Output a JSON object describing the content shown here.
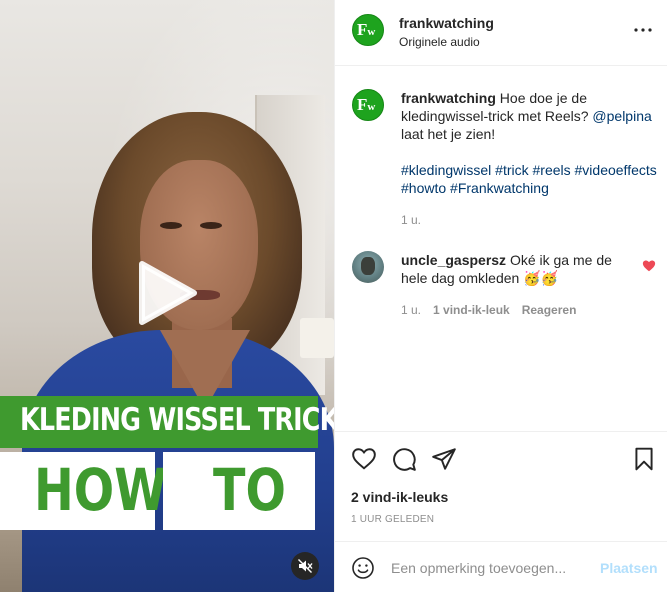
{
  "post": {
    "username": "frankwatching",
    "audio": "Originele audio",
    "avatar_text": "Fw",
    "caption_user": "frankwatching",
    "caption_text": "Hoe doe je de kledingwissel-trick met Reels?",
    "caption_mention": "@pelpina",
    "caption_rest": "laat het je zien!",
    "hashtags": "#kledingwissel #trick #reels #videoeffects #howto #Frankwatching",
    "caption_age": "1 u.",
    "likes": "2 vind-ik-leuks",
    "timestamp": "1 UUR GELEDEN"
  },
  "video": {
    "banner_title": "KLEDING WISSEL TRICK",
    "word_left": "HOW",
    "word_right": "TO",
    "play_icon": "play-icon",
    "mute_icon": "muted-speaker-icon"
  },
  "comment": {
    "username": "uncle_gaspersz",
    "text": "Oké ik ga me de hele dag omkleden 🥳🥳",
    "age": "1 u.",
    "likes": "1 vind-ik-leuk",
    "reply": "Reageren",
    "liked": true
  },
  "composer": {
    "placeholder": "Een opmerking toevoegen...",
    "post_label": "Plaatsen"
  },
  "colors": {
    "brand_green": "#3f9a2f",
    "link": "#00376b",
    "muted": "#8e8e8e",
    "like_red": "#ed4956",
    "post_disabled": "#b2dffc"
  }
}
